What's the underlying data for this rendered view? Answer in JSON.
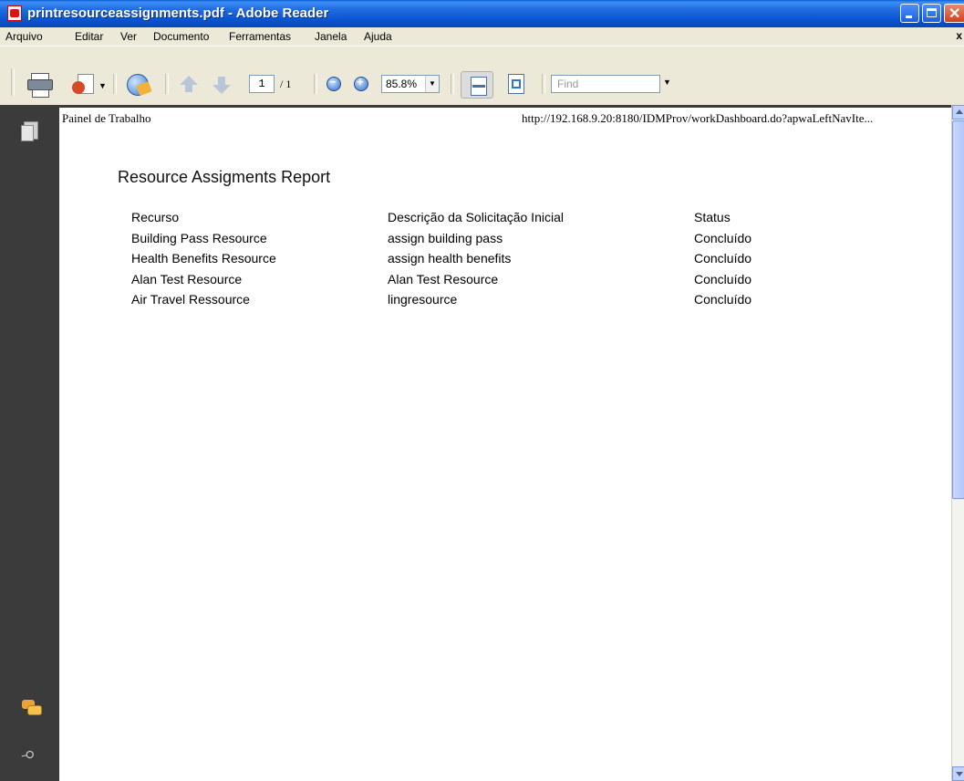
{
  "window": {
    "title": "printresourceassignments.pdf - Adobe Reader"
  },
  "menu": {
    "items": [
      "Arquivo",
      "Editar",
      "Ver",
      "Documento",
      "Ferramentas",
      "Janela",
      "Ajuda"
    ],
    "close_glyph": "x"
  },
  "toolbar": {
    "page_current": "1",
    "page_total": "/ 1",
    "zoom": "85.8%",
    "find_placeholder": "Find",
    "icons": [
      "printer-icon",
      "review-icon",
      "secure-icon",
      "previous-page-icon",
      "next-page-icon",
      "zoom-out-icon",
      "zoom-in-icon",
      "fit-width-icon",
      "fit-page-icon"
    ]
  },
  "leftnav": {
    "icons": [
      "pages-icon",
      "comments-icon",
      "attachments-icon"
    ]
  },
  "document": {
    "header_left": "Painel de Trabalho",
    "header_right": "http://192.168.9.20:8180/IDMProv/workDashboard.do?apwaLeftNavIte...",
    "report_title": "Resource Assigments Report",
    "columns": [
      "Recurso",
      "Descrição da Solicitação Inicial",
      "Status"
    ],
    "rows": [
      [
        "Building Pass Resource",
        "assign building pass",
        "Concluído"
      ],
      [
        "Health Benefits Resource",
        "assign health benefits",
        "Concluído"
      ],
      [
        "Alan Test Resource",
        "Alan Test Resource",
        "Concluído"
      ],
      [
        "Air Travel Ressource",
        "lingresource",
        "Concluído"
      ]
    ]
  }
}
